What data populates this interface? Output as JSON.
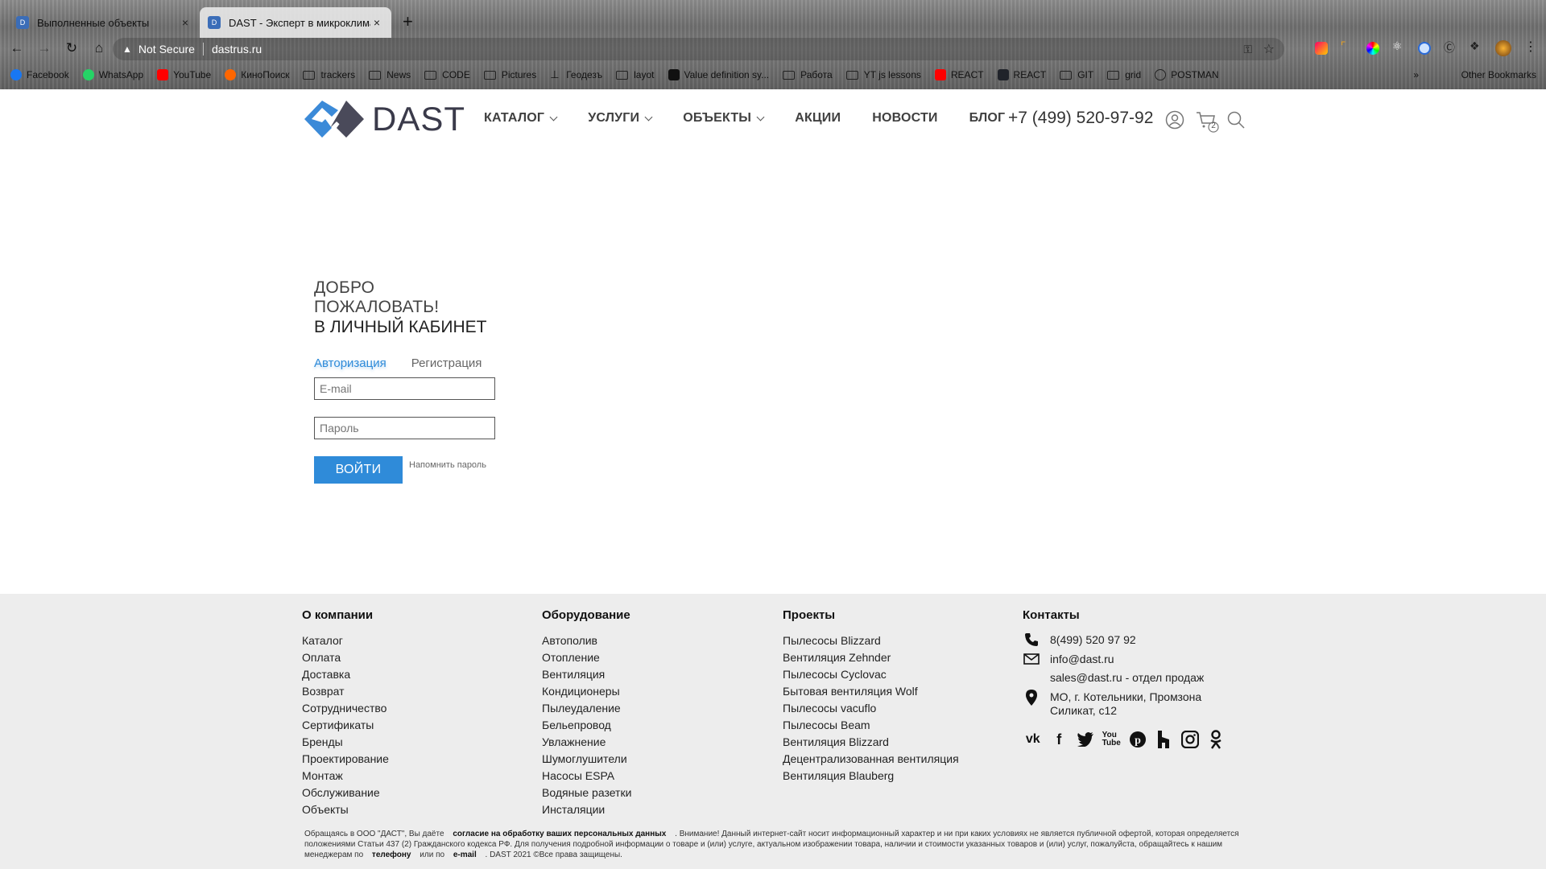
{
  "browser": {
    "tabs": [
      {
        "title": "Выполненные объекты",
        "close": "×"
      },
      {
        "title": "DAST - Эксперт в микроклимате",
        "close": "×"
      }
    ],
    "new_tab": "+",
    "security": "Not Secure",
    "url": "dastrus.ru",
    "bookmarks": [
      "Facebook",
      "WhatsApp",
      "YouTube",
      "КиноПоиск",
      "trackers",
      "News",
      "CODE",
      "Pictures",
      "Геодезъ",
      "layot",
      "Value definition sy...",
      "Работа",
      "YT js lessons",
      "REACT",
      "REACT",
      "GIT",
      "grid",
      "POSTMAN"
    ],
    "bookmarks_more": "»",
    "other_bookmarks": "Other Bookmarks"
  },
  "header": {
    "logo_text": "DAST",
    "nav": [
      "КАТАЛОГ",
      "УСЛУГИ",
      "ОБЪЕКТЫ",
      "АКЦИИ",
      "НОВОСТИ",
      "БЛОГ"
    ],
    "phone": "+7 (499) 520-97-92",
    "cart_count": "2"
  },
  "login": {
    "welcome_line1": "ДОБРО ПОЖАЛОВАТЬ!",
    "welcome_line2": "В ЛИЧНЫЙ КАБИНЕТ",
    "tab_login": "Авторизация",
    "tab_register": "Регистрация",
    "email_placeholder": "E-mail",
    "password_placeholder": "Пароль",
    "submit": "ВОЙТИ",
    "remind": "Напомнить пароль"
  },
  "footer": {
    "col1": {
      "title": "О компании",
      "items": [
        "Каталог",
        "Оплата",
        "Доставка",
        "Возврат",
        "Сотрудничество",
        "Сертификаты",
        "Бренды",
        "Проектирование",
        "Монтаж",
        "Обслуживание",
        "Объекты"
      ]
    },
    "col2": {
      "title": "Оборудование",
      "items": [
        "Автополив",
        "Отопление",
        "Вентиляция",
        "Кондиционеры",
        "Пылеудаление",
        "Бельепровод",
        "Увлажнение",
        "Шумоглушители",
        "Насосы ESPA",
        "Водяные разетки",
        "Инсталяции"
      ]
    },
    "col3": {
      "title": "Проекты",
      "items": [
        "Пылесосы Blizzard",
        "Вентиляция Zehnder",
        "Пылесосы Cyclovac",
        "Бытовая вентиляция Wolf",
        "Пылесосы vacuflo",
        "Пылесосы Beam",
        "Вентиляция Blizzard",
        "Децентрализованная вентиляция",
        "Вентиляция Blauberg"
      ]
    },
    "contacts": {
      "title": "Контакты",
      "phone": "8(499) 520 97 92",
      "email": "info@dast.ru",
      "sales": "sales@dast.ru - отдел продаж",
      "address": "МО, г. Котельники, Промзона Силикат, с12"
    },
    "legal": {
      "part1": "Обращаясь в ООО \"ДАСТ\", Вы даёте",
      "link1": "согласие на обработку ваших персональных данных",
      "part2": ". Внимание! Данный интернет-сайт носит информационный характер и ни при каких условиях не является публичной офертой, которая определяется положениями Статьи 437 (2) Гражданского кодекса РФ. Для получения подробной информации о товаре и (или) услуге, актуальном изображении товара, наличии и стоимости указанных товаров и (или) услуг, пожалуйста, обращайтесь к нашим менеджерам по",
      "link2": "телефону",
      "part3": "или по",
      "link3": "e-mail",
      "part4": ". DAST 2021 ©Все права защищены."
    }
  },
  "colors": {
    "accent": "#2f8bd9",
    "footer_bg": "#ededed",
    "logo_blue": "#3b8ad8",
    "logo_gray": "#4a4a5a"
  }
}
